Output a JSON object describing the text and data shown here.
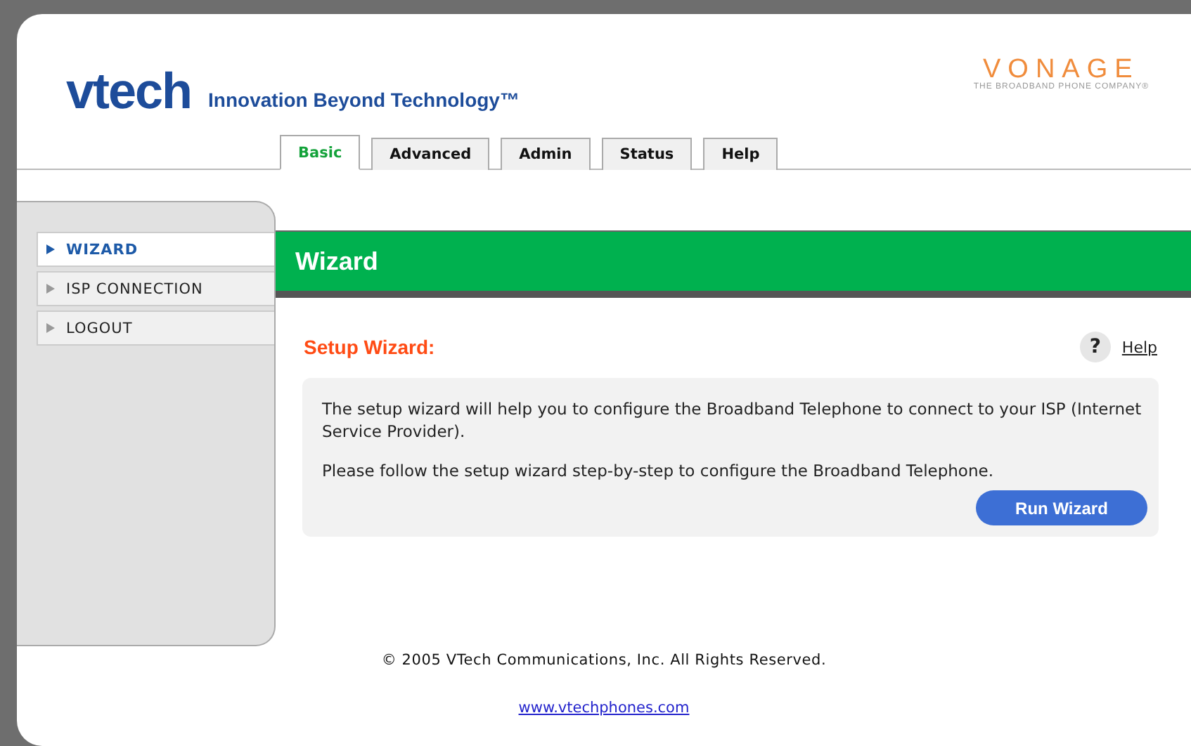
{
  "header": {
    "logo": "vtech",
    "tagline": "Innovation Beyond Technology™",
    "partner_logo": "VONAGE",
    "partner_tagline": "THE BROADBAND PHONE COMPANY®"
  },
  "tabs": [
    {
      "label": "Basic",
      "selected": true
    },
    {
      "label": "Advanced",
      "selected": false
    },
    {
      "label": "Admin",
      "selected": false
    },
    {
      "label": "Status",
      "selected": false
    },
    {
      "label": "Help",
      "selected": false
    }
  ],
  "sidebar": {
    "items": [
      {
        "label": "WIZARD",
        "selected": true
      },
      {
        "label": "ISP CONNECTION",
        "selected": false
      },
      {
        "label": "LOGOUT",
        "selected": false
      }
    ]
  },
  "banner": {
    "title": "Wizard"
  },
  "section": {
    "title": "Setup Wizard:",
    "help_link": "Help",
    "help_icon": "?"
  },
  "panel": {
    "paragraphs": [
      "The setup wizard will help you to configure the Broadband Telephone to connect to your ISP (Internet Service Provider).",
      "Please follow the setup wizard step-by-step to configure the Broadband Telephone."
    ],
    "button": "Run Wizard"
  },
  "footer": {
    "copyright": "© 2005 VTech Communications, Inc. All Rights Reserved.",
    "link": "www.vtechphones.com"
  }
}
